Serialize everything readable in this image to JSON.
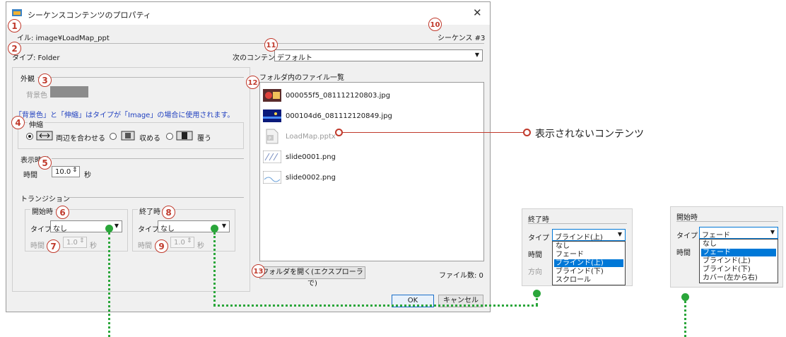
{
  "dialog": {
    "title": "シーケンスコンテンツのプロパティ",
    "close_glyph": "✕",
    "file_label": "ファイル: image¥LoadMap_ppt",
    "file_label_visible": "イル: image¥LoadMap_ppt",
    "sequence_label": "シーケンス #3",
    "type_label": "タイプ: Folder",
    "next_content_label": "次のコンテンツ",
    "next_content_value": "デフォルト",
    "appearance_group": "外観",
    "bgcolor_label": "背景色",
    "bgcolor_swatch": "#8c8c8c",
    "note": "「背景色」と「伸縮」はタイプが「Image」の場合に使用されます。",
    "stretch_group": "伸縮",
    "stretch_options": [
      "両辺を合わせる",
      "収める",
      "覆う"
    ],
    "display_time_group": "表示時間",
    "time_label": "時間",
    "time_value": "10.0",
    "time_unit": "秒",
    "transition_group": "トランジション",
    "start_group": "開始時",
    "end_group": "終了時",
    "type_field_label": "タイプ",
    "start_type_value": "なし",
    "end_type_value": "なし",
    "sub_time_value": "1.0",
    "file_list_label": "フォルダ内のファイル一覧",
    "files": [
      {
        "name": "000055f5_081112120803.jpg",
        "disabled": false
      },
      {
        "name": "000104d6_081112120849.jpg",
        "disabled": false
      },
      {
        "name": "LoadMap.pptx",
        "disabled": true
      },
      {
        "name": "slide0001.png",
        "disabled": false
      },
      {
        "name": "slide0002.png",
        "disabled": false
      }
    ],
    "open_folder_button": "フォルダを開く(エクスプローラで)",
    "file_count": "ファイル数: 0",
    "ok_button": "OK",
    "cancel_button": "キャンセル"
  },
  "badges": [
    "1",
    "2",
    "3",
    "4",
    "5",
    "6",
    "7",
    "8",
    "9",
    "10",
    "11",
    "12",
    "13"
  ],
  "callout": "表示されないコンテンツ",
  "end_panel": {
    "title": "終了時",
    "type_label": "タイプ",
    "selected": "ブラインド(上)",
    "time_label": "時間",
    "direction_label": "方向",
    "options": [
      "なし",
      "フェード",
      "ブラインド(上)",
      "ブラインド(下)",
      "スクロール"
    ],
    "highlighted": "ブラインド(上)"
  },
  "start_panel": {
    "title": "開始時",
    "type_label": "タイプ",
    "selected": "フェード",
    "time_label": "時間",
    "options": [
      "なし",
      "フェード",
      "ブラインド(上)",
      "ブラインド(下)",
      "カバー(左から右)"
    ],
    "highlighted": "フェード"
  },
  "colors": {
    "accent": "#c0392b",
    "connector": "#2aa63a",
    "selection": "#0078d7",
    "note_text": "#1f3fbf"
  }
}
